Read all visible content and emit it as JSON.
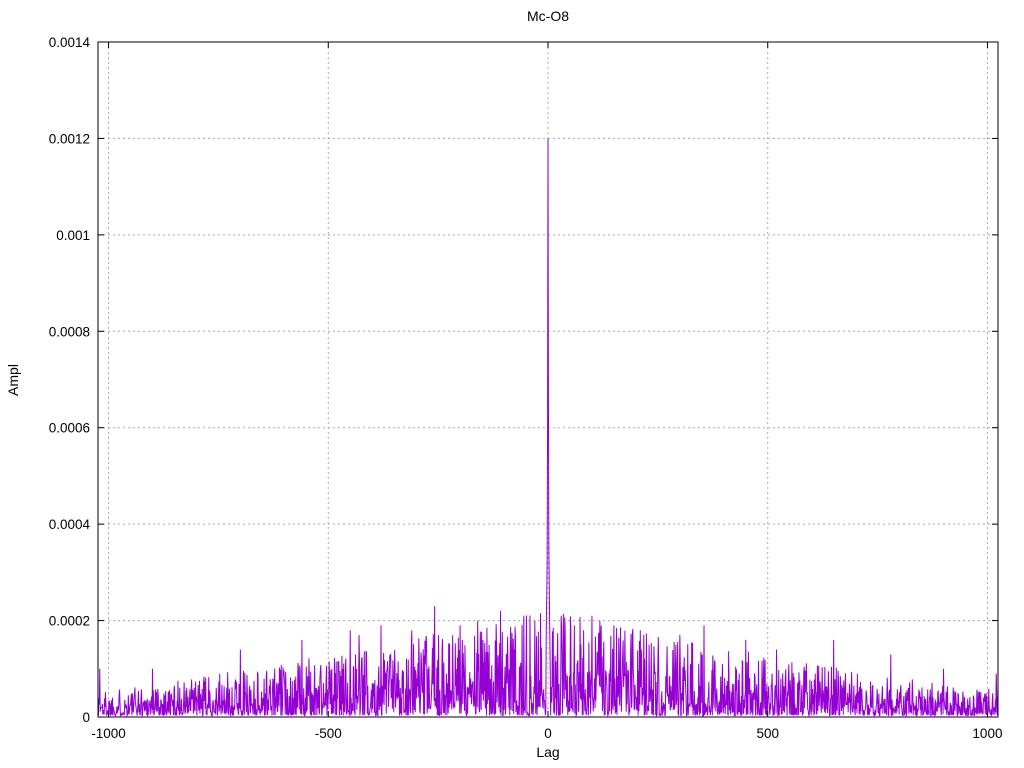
{
  "page": {
    "background": "#ffffff"
  },
  "chart_data": {
    "type": "line",
    "title": "Mc-O8",
    "xlabel": "Lag",
    "ylabel": "Ampl",
    "xlim": [
      -1024,
      1024
    ],
    "ylim": [
      0,
      0.0014
    ],
    "grid": true,
    "legend_position": "none",
    "line_color": "#9400d3",
    "grid_color": "#a8a8a8",
    "axis_color": "#000000",
    "x_ticks": [
      {
        "v": -1000,
        "label": "-1000"
      },
      {
        "v": -500,
        "label": "-500"
      },
      {
        "v": 0,
        "label": "0"
      },
      {
        "v": 500,
        "label": "500"
      },
      {
        "v": 1000,
        "label": "1000"
      }
    ],
    "y_ticks": [
      {
        "v": 0,
        "label": "0"
      },
      {
        "v": 0.0002,
        "label": "0.0002"
      },
      {
        "v": 0.0004,
        "label": "0.0004"
      },
      {
        "v": 0.0006,
        "label": "0.0006"
      },
      {
        "v": 0.0008,
        "label": "0.0008"
      },
      {
        "v": 0.001,
        "label": "0.001"
      },
      {
        "v": 0.0012,
        "label": "0.0012"
      },
      {
        "v": 0.0014,
        "label": "0.0014"
      }
    ],
    "peak": {
      "lag": 0,
      "ampl": 0.0012
    },
    "key_points": [
      [
        -3,
        0.00024
      ],
      [
        -2,
        0.00032
      ],
      [
        -1,
        0.00059
      ],
      [
        0,
        0.0012
      ],
      [
        1,
        0.00066
      ],
      [
        2,
        0.00035
      ],
      [
        3,
        0.00026
      ]
    ],
    "outlier_points": [
      [
        -1020,
        0.0001
      ],
      [
        -900,
        0.0001
      ],
      [
        -700,
        0.00014
      ],
      [
        -560,
        0.00016
      ],
      [
        -450,
        0.00018
      ],
      [
        -430,
        0.00017
      ],
      [
        -380,
        0.00019
      ],
      [
        -310,
        0.00018
      ],
      [
        -258,
        0.00023
      ],
      [
        -200,
        0.00019
      ],
      [
        -160,
        0.0002
      ],
      [
        -108,
        0.00022
      ],
      [
        -55,
        0.00021
      ],
      [
        -30,
        0.0002
      ],
      [
        30,
        0.00021
      ],
      [
        60,
        0.00019
      ],
      [
        100,
        0.00021
      ],
      [
        150,
        0.00019
      ],
      [
        210,
        0.00018
      ],
      [
        300,
        0.00017
      ],
      [
        355,
        0.00019
      ],
      [
        450,
        0.00016
      ],
      [
        520,
        0.00014
      ],
      [
        650,
        0.00016
      ],
      [
        780,
        0.00013
      ],
      [
        900,
        0.0001
      ],
      [
        1020,
        9e-05
      ]
    ],
    "noise_model": {
      "seed": 1337,
      "lag_from": -1024,
      "lag_to": 1024,
      "floor": 3e-06,
      "base": 5.5e-05,
      "amp": 0.000165,
      "power": 1.25,
      "shape": 2.0
    }
  }
}
